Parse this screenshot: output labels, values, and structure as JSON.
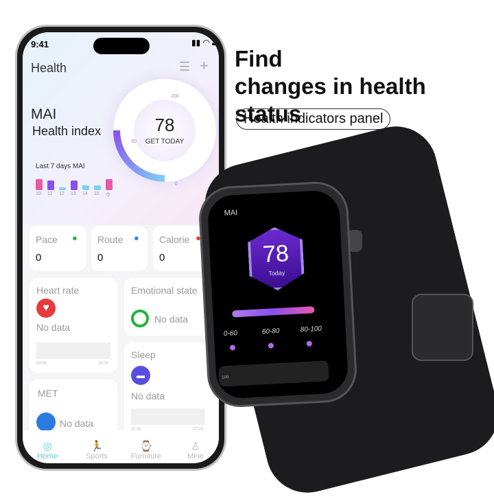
{
  "headline": {
    "line1": "Find",
    "line2": "changes in health status",
    "tag": "Health indicators panel"
  },
  "phone": {
    "status_time": "9:41",
    "title": "Health",
    "mai_label": "MAI",
    "health_index": "Health index",
    "score": "78",
    "score_caption": "GET TODAY",
    "ring_ticks": [
      "100",
      "50",
      "0"
    ],
    "week_label": "Last 7 days MAI",
    "week_days": [
      "10",
      "11",
      "12",
      "13",
      "14",
      "15",
      "今"
    ],
    "week_bars": [
      {
        "level": 0.9,
        "color": "#e85aa8"
      },
      {
        "level": 0.8,
        "color": "#8a4ef0"
      },
      {
        "level": 0.2,
        "color": "#7fd0f5"
      },
      {
        "level": 0.8,
        "color": "#8a4ef0"
      },
      {
        "level": 0.4,
        "color": "#7fd0f5"
      },
      {
        "level": 0.4,
        "color": "#7fd0f5"
      },
      {
        "level": 0.9,
        "color": "#e85aa8"
      }
    ],
    "stats": [
      {
        "label": "Pace",
        "value": "0",
        "icon": "shoe-icon",
        "color": "#2bb34a"
      },
      {
        "label": "Route",
        "value": "0",
        "icon": "location-pin-icon",
        "color": "#2a8ae8"
      },
      {
        "label": "Calorie",
        "value": "0",
        "icon": "flame-icon",
        "color": "#e8402a"
      }
    ],
    "heart": {
      "label": "Heart rate",
      "status": "No data",
      "t0": "00:00",
      "t1": "24:00",
      "color": "#e83a3a"
    },
    "emotion": {
      "label": "Emotional state",
      "status": "No data",
      "color": "#22b33a"
    },
    "sleep": {
      "label": "Sleep",
      "status": "No data",
      "t0": "22:00",
      "t1": "07:24",
      "color": "#5a4ee0"
    },
    "met": {
      "label": "MET",
      "status": "No data",
      "color": "#2a7ae0"
    },
    "tabs": [
      {
        "label": "Home",
        "active": true
      },
      {
        "label": "Sports"
      },
      {
        "label": "Furniture"
      },
      {
        "label": "Mine"
      }
    ],
    "accent": "#5cc8d8"
  },
  "watch": {
    "title": "MAI",
    "score": "78",
    "caption": "Today",
    "ranges": [
      "0-60",
      "60-80",
      "80-100"
    ],
    "bottom_label": "100"
  }
}
